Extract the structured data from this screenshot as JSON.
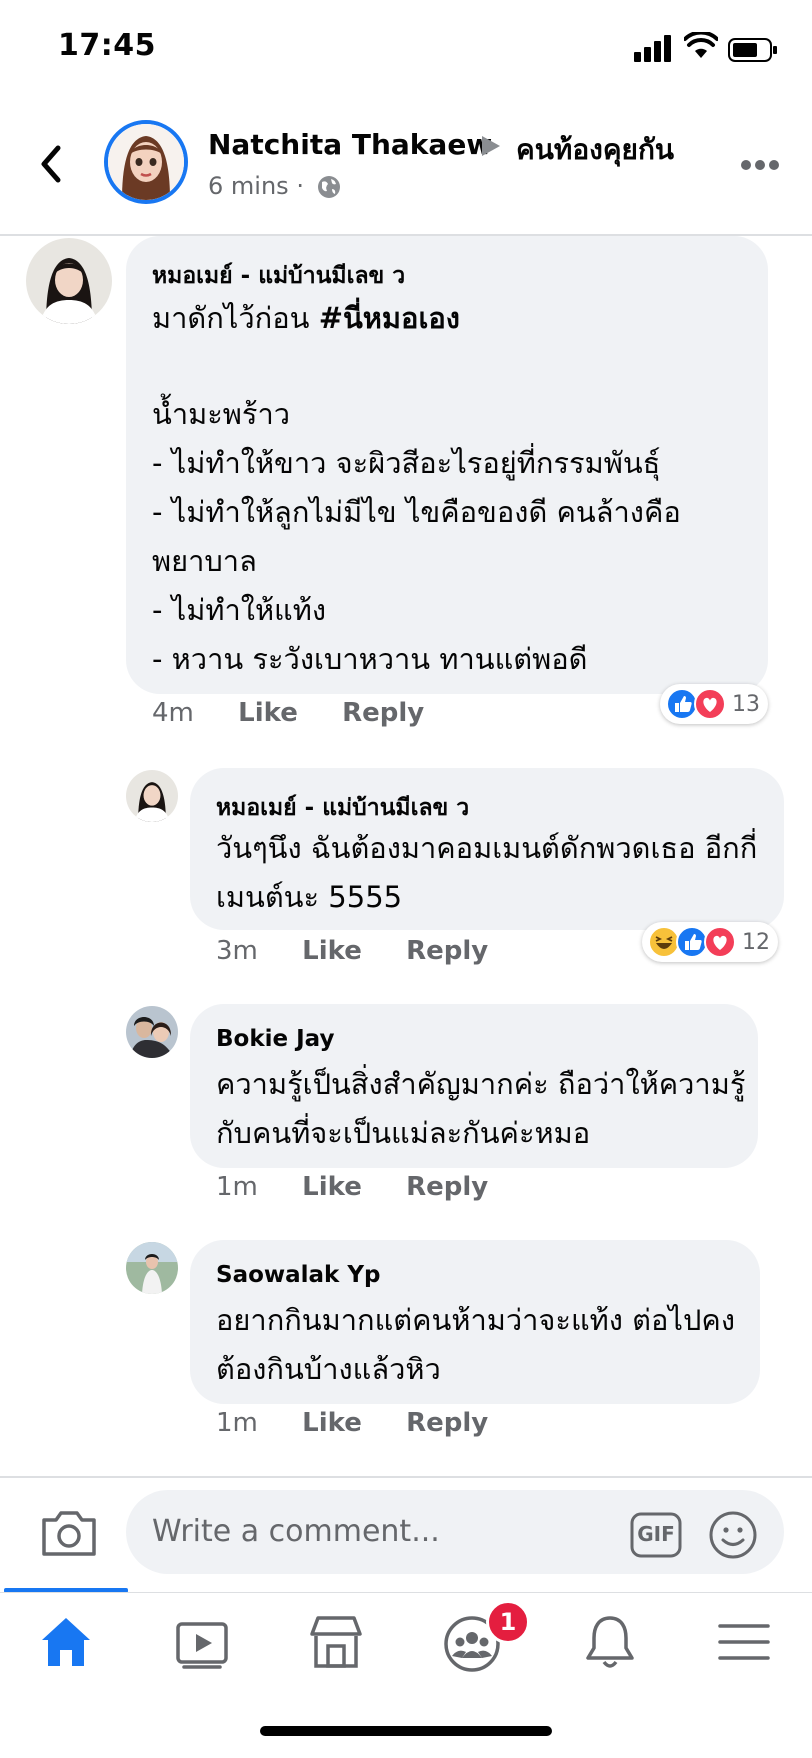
{
  "status_bar": {
    "time": "17:45"
  },
  "post": {
    "author": "Natchita Thakaew",
    "group": "คนท้องคุยกัน",
    "time": "6 mins",
    "separator": "·"
  },
  "comments": [
    {
      "name": "หมอเมย์ - แม่บ้านมีเลข ว",
      "text_intro": "มาดักไว้ก่อน ",
      "hashtag": "#นี่หมอเอง",
      "text_body": "น้ำมะพร้าว\n- ไม่ทำให้ขาว จะผิวสีอะไรอยู่ที่กรรมพันธุ์\n- ไม่ทำให้ลูกไม่มีไข ไขคือของดี คนล้างคือพยาบาล\n- ไม่ทำให้แท้ง\n- หวาน ระวังเบาหวาน ทานแต่พอดี",
      "time": "4m",
      "like": "Like",
      "reply": "Reply",
      "reaction_count": "13"
    },
    {
      "name": "หมอเมย์ - แม่บ้านมีเลข ว",
      "text": "วันๆนึง ฉันต้องมาคอมเมนต์ดักพวดเธอ อีกกี่เมนต์นะ 5555",
      "time": "3m",
      "like": "Like",
      "reply": "Reply",
      "reaction_count": "12"
    },
    {
      "name": "Bokie Jay",
      "text": "ความรู้เป็นสิ่งสำคัญมากค่ะ ถือว่าให้ความรู้กับคนที่จะเป็นแม่ละกันค่ะหมอ",
      "time": "1m",
      "like": "Like",
      "reply": "Reply"
    },
    {
      "name": "Saowalak Yp",
      "text": "อยากกินมากแต่คนห้ามว่าจะแท้ง  ต่อไปคงต้องกินบ้างแล้วหิว",
      "time": "1m",
      "like": "Like",
      "reply": "Reply"
    }
  ],
  "composer": {
    "placeholder": "Write a comment...",
    "gif_label": "GIF"
  },
  "tab_bar": {
    "items": [
      "home-icon",
      "video-icon",
      "marketplace-icon",
      "groups-icon",
      "notifications-icon",
      "menu-icon"
    ],
    "groups_badge": "1"
  },
  "colors": {
    "accent": "#1877f2",
    "bubble": "#f0f2f5",
    "badge": "#e41e3f",
    "love": "#f33e58"
  }
}
